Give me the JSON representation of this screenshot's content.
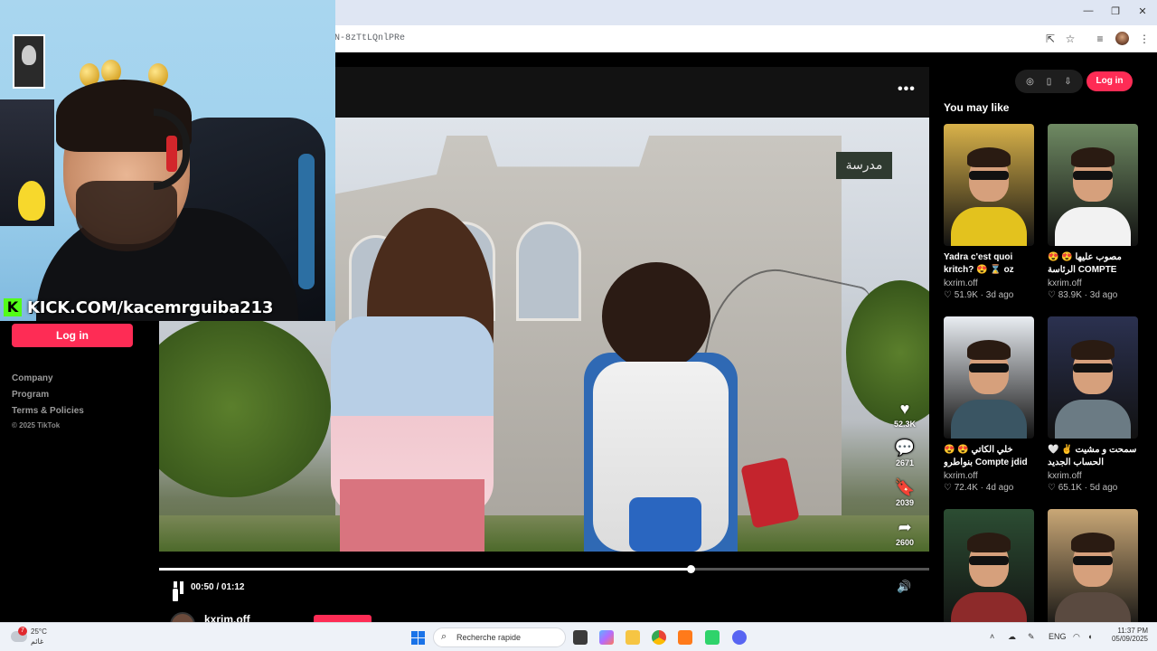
{
  "browser": {
    "url": "N-8zTtLQnlPRe",
    "window_controls": {
      "minimize": "—",
      "restore": "❐",
      "close": "✕"
    }
  },
  "stream_overlay": {
    "kick_logo": "K",
    "channel": "KICK.COM/kacemrguiba213"
  },
  "left_nav": {
    "login_label": "Log in",
    "links": [
      "Company",
      "Program",
      "Terms & Policies"
    ],
    "copyright": "© 2025 TikTok"
  },
  "video": {
    "school_sign": "مدرسة",
    "more_icon": "•••",
    "progress": 0.69,
    "elapsed": "00:50",
    "duration": "01:12",
    "time_display": "00:50 / 01:12",
    "author": "kxrim.off",
    "actions": [
      {
        "name": "like",
        "icon": "♥",
        "count": "52.3K"
      },
      {
        "name": "comment",
        "icon": "💬",
        "count": "2671"
      },
      {
        "name": "save",
        "icon": "🔖",
        "count": "2039"
      },
      {
        "name": "share",
        "icon": "➦",
        "count": "2600"
      }
    ]
  },
  "right_panel": {
    "toolbar_icons": [
      "compass-icon",
      "phone-icon",
      "download-icon"
    ],
    "login_label": "Log in",
    "heading": "You may like",
    "cards": [
      {
        "title": "Yadra c'est quoi kritch? 😍 ⌛ oz",
        "user": "kxrim.off",
        "likes": "51.9K",
        "age": "3d ago",
        "bg": "#d9b24a",
        "shirt": "#e3c21e"
      },
      {
        "title": "😍 😍 مصوب عليها الرئاسة COMPTE JDID DYA...",
        "user": "kxrim.off",
        "likes": "83.9K",
        "age": "3d ago",
        "bg": "#6f8a63",
        "shirt": "#f2f2f2"
      },
      {
        "title": "😍 😍 خلي الكاتي بنواطرو Compte jdid dyali...",
        "user": "kxrim.off",
        "likes": "72.4K",
        "age": "4d ago",
        "bg": "#e9edf2",
        "shirt": "#3a5563"
      },
      {
        "title": "🤍 ✌ سمحت و مشيت الحساب الجديد متنساش...",
        "user": "kxrim.off",
        "likes": "65.1K",
        "age": "5d ago",
        "bg": "#2b3150",
        "shirt": "#6b7b84"
      },
      {
        "title": "",
        "user": "",
        "likes": "",
        "age": "",
        "bg": "#2c4d33",
        "shirt": "#8d2a2a"
      },
      {
        "title": "",
        "user": "",
        "likes": "",
        "age": "",
        "bg": "#c9a776",
        "shirt": "#5a4a40"
      }
    ]
  },
  "taskbar": {
    "weather_badge": "7",
    "temperature": "25°C",
    "weather_desc": "غائم",
    "search_placeholder": "Recherche rapide",
    "language": "ENG",
    "time": "11:37 PM",
    "date": "05/09/2025"
  }
}
